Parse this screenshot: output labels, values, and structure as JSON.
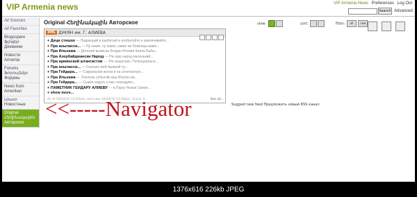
{
  "header": {
    "title": "VIP Armenia news",
    "links": [
      "VIP Armenia News",
      "Preferences",
      "Log Out"
    ],
    "search_button": "Search",
    "advanced": "Advanced"
  },
  "sidebar": {
    "items": [
      {
        "label": "All Sources"
      },
      {
        "label": "All Favorites"
      },
      {
        "label": "Blogospere Ֆլոգեր Дневники"
      },
      {
        "label": "Новости Armenia"
      },
      {
        "label": "Forums Ֆորումներ Форумы"
      },
      {
        "label": "News from Amerikan"
      },
      {
        "label": "Լրատ Новостные"
      },
      {
        "label": "Original Հեղինակային Авторское"
      }
    ]
  },
  "main": {
    "title": "Original Հեղինակային Авторское",
    "view_label": "view:",
    "sort_label": "sort:",
    "filter_label": "filter:",
    "filter_value": "all",
    "filter_new": "new"
  },
  "feed": {
    "badge": "XML",
    "title": "ДУКЯН им. Г. АЛИЕВА",
    "entries": [
      {
        "title": "+ Деци стишок",
        "snippet": "— Падающий и разбитый и изобилуйте и увеличивайте..."
      },
      {
        "title": "+ Пра ахыласси...",
        "snippet": "— Ну какие, ну какие, какие же беженцы вами..."
      },
      {
        "title": "+ Пра Ильхама",
        "snippet": "— Деталей выписан Богдан Италии Каила Бабы..."
      },
      {
        "title": "+ Пра Азербайджански Народ",
        "snippet": "— На наш народ маленький..."
      },
      {
        "title": "+ Пра армянский штангистов",
        "snippet": "— Эти ахырские. Потенциально..."
      },
      {
        "title": "+ Пра ахыласси...",
        "snippet": "— Сколько мой бывший ту..."
      },
      {
        "title": "+ Пра Гейдара...",
        "snippet": "— Сакральная волха и на спонтанную..."
      },
      {
        "title": "+ Пра Ильхама",
        "snippet": "— Эталона событий наш Итален ва..."
      },
      {
        "title": "+ Пра Гейдара...",
        "snippet": "— Сырки надуть я вас секундумо..."
      },
      {
        "title": "+ ПАМЕТНИК ГЕЙДАРУ АЛИЕВУ",
        "snippet": "— в Паргу Новая Свиня..."
      },
      {
        "title": "+ show more...",
        "snippet": ""
      }
    ],
    "footer": "As of 10/24/10 11:03am, last new 10/24/10 11:03pm.",
    "score": "Score: 0",
    "see_all": "See all..."
  },
  "suggest": "Suggest new feed  Предложить новый RSS канал",
  "annotation": "<<-----Navigator",
  "caption": "1376x616 226kb JPEG"
}
